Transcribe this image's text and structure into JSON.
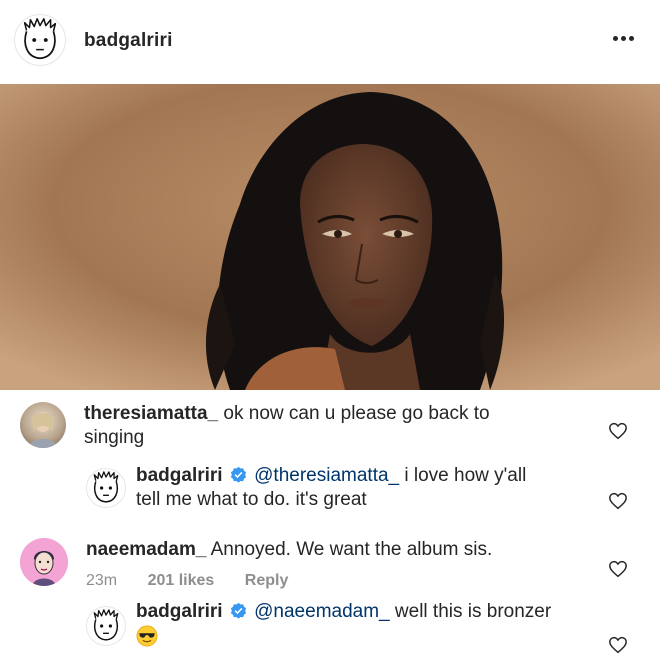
{
  "post": {
    "username": "badgalriri",
    "menu_icon": "more-horizontal-icon"
  },
  "comments": [
    {
      "username": "theresiamatta_",
      "text": " ok now can u please go back to",
      "text2": "singing"
    },
    {
      "username": "badgalriri",
      "mention": "@theresiamatta_",
      "text": " i love how y'all",
      "text2": "tell me what to do. it's great"
    },
    {
      "username": "naeemadam_",
      "text": " Annoyed. We want the album sis.",
      "time": "23m",
      "likes": "201 likes",
      "reply": "Reply"
    },
    {
      "username": "badgalriri",
      "mention": "@naeemadam_",
      "text": " well this is bronzer",
      "emoji": "sunglasses-emoji"
    }
  ],
  "colors": {
    "text": "#262626",
    "mention": "#003569",
    "meta": "#8e8e8e",
    "verified": "#3897f0"
  }
}
